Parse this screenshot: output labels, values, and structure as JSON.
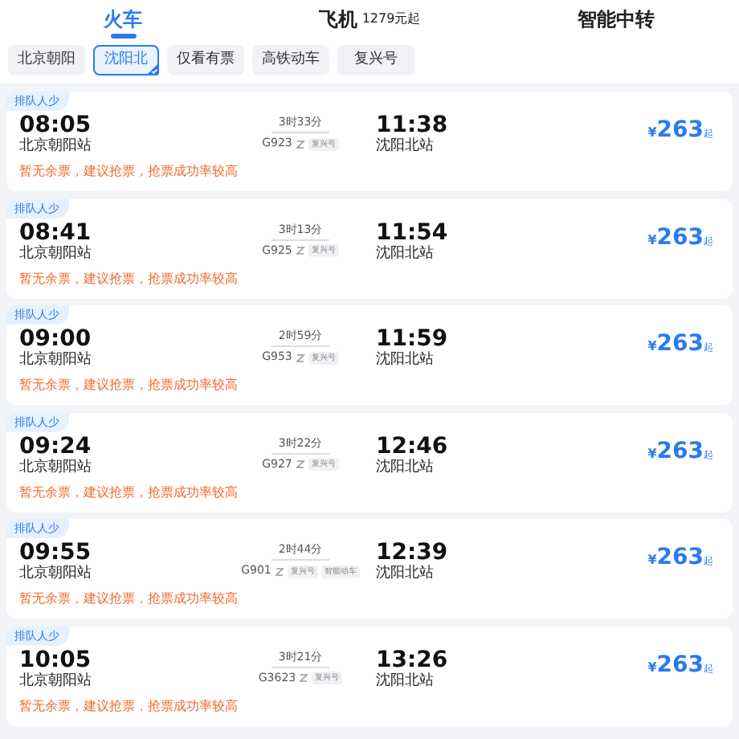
{
  "tabs": [
    {
      "label": "火车",
      "selected": true
    },
    {
      "label": "飞机",
      "note": "1279元起",
      "selected": false
    },
    {
      "label": "智能中转",
      "selected": false
    }
  ],
  "filters": [
    {
      "label": "北京朝阳",
      "selected": false
    },
    {
      "label": "沈阳北",
      "selected": true
    },
    {
      "label": "仅看有票",
      "selected": false
    },
    {
      "label": "高铁动车",
      "selected": false
    },
    {
      "label": "复兴号",
      "selected": false
    }
  ],
  "trains": [
    {
      "badge": "排队人少",
      "depart_time": "08:05",
      "depart_station": "北京朝阳站",
      "duration": "3时33分",
      "number": "G923",
      "tags": [
        "复兴号"
      ],
      "arrive_time": "11:38",
      "arrive_station": "沈阳北站",
      "currency": "¥",
      "price": "263",
      "price_suffix": "起",
      "notice": "暂无余票，建议抢票，抢票成功率较高"
    },
    {
      "badge": "排队人少",
      "depart_time": "08:41",
      "depart_station": "北京朝阳站",
      "duration": "3时13分",
      "number": "G925",
      "tags": [
        "复兴号"
      ],
      "arrive_time": "11:54",
      "arrive_station": "沈阳北站",
      "currency": "¥",
      "price": "263",
      "price_suffix": "起",
      "notice": "暂无余票，建议抢票，抢票成功率较高"
    },
    {
      "badge": "排队人少",
      "depart_time": "09:00",
      "depart_station": "北京朝阳站",
      "duration": "2时59分",
      "number": "G953",
      "tags": [
        "复兴号"
      ],
      "arrive_time": "11:59",
      "arrive_station": "沈阳北站",
      "currency": "¥",
      "price": "263",
      "price_suffix": "起",
      "notice": "暂无余票，建议抢票，抢票成功率较高"
    },
    {
      "badge": "排队人少",
      "depart_time": "09:24",
      "depart_station": "北京朝阳站",
      "duration": "3时22分",
      "number": "G927",
      "tags": [
        "复兴号"
      ],
      "arrive_time": "12:46",
      "arrive_station": "沈阳北站",
      "currency": "¥",
      "price": "263",
      "price_suffix": "起",
      "notice": "暂无余票，建议抢票，抢票成功率较高"
    },
    {
      "badge": "排队人少",
      "depart_time": "09:55",
      "depart_station": "北京朝阳站",
      "duration": "2时44分",
      "number": "G901",
      "tags": [
        "复兴号",
        "智能动车"
      ],
      "arrive_time": "12:39",
      "arrive_station": "沈阳北站",
      "currency": "¥",
      "price": "263",
      "price_suffix": "起",
      "notice": "暂无余票，建议抢票，抢票成功率较高"
    },
    {
      "badge": "排队人少",
      "depart_time": "10:05",
      "depart_station": "北京朝阳站",
      "duration": "3时21分",
      "number": "G3623",
      "tags": [
        "复兴号"
      ],
      "arrive_time": "13:26",
      "arrive_station": "沈阳北站",
      "currency": "¥",
      "price": "263",
      "price_suffix": "起",
      "notice": "暂无余票，建议抢票，抢票成功率较高"
    }
  ]
}
